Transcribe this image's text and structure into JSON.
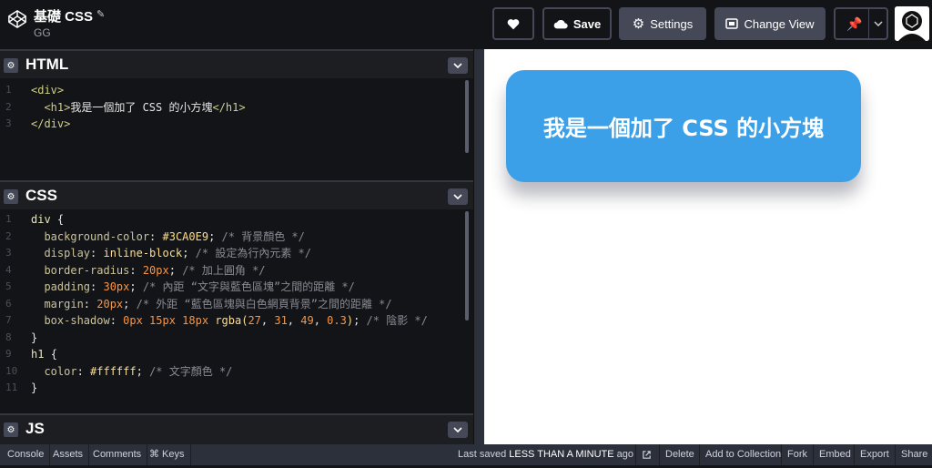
{
  "app": {
    "title": "基礎 CSS",
    "author": "GG"
  },
  "toolbar": {
    "save_label": "Save",
    "settings_label": "Settings",
    "change_view_label": "Change View"
  },
  "panels": {
    "html": {
      "label": "HTML",
      "lines": [
        {
          "n": "1",
          "parts": [
            {
              "c": "tag",
              "t": "<div>"
            }
          ]
        },
        {
          "n": "2",
          "parts": [
            {
              "c": "",
              "t": "  "
            },
            {
              "c": "tag",
              "t": "<h1>"
            },
            {
              "c": "",
              "t": "我是一個加了 CSS 的小方塊"
            },
            {
              "c": "tag",
              "t": "</h1>"
            }
          ]
        },
        {
          "n": "3",
          "parts": [
            {
              "c": "tag",
              "t": "</div>"
            }
          ]
        }
      ]
    },
    "css": {
      "label": "CSS",
      "lines": [
        {
          "n": "1",
          "parts": [
            {
              "c": "sel",
              "t": "div "
            },
            {
              "c": "",
              "t": "{"
            }
          ]
        },
        {
          "n": "2",
          "parts": [
            {
              "c": "prop",
              "t": "  background-color"
            },
            {
              "c": "",
              "t": ": "
            },
            {
              "c": "ident",
              "t": "#3CA0E9"
            },
            {
              "c": "",
              "t": "; "
            },
            {
              "c": "cmt",
              "t": "/* 背景顏色 */"
            }
          ]
        },
        {
          "n": "3",
          "parts": [
            {
              "c": "prop",
              "t": "  display"
            },
            {
              "c": "",
              "t": ": "
            },
            {
              "c": "ident",
              "t": "inline-block"
            },
            {
              "c": "",
              "t": "; "
            },
            {
              "c": "cmt",
              "t": "/* 設定為行內元素 */"
            }
          ]
        },
        {
          "n": "4",
          "parts": [
            {
              "c": "prop",
              "t": "  border-radius"
            },
            {
              "c": "",
              "t": ": "
            },
            {
              "c": "num",
              "t": "20px"
            },
            {
              "c": "",
              "t": "; "
            },
            {
              "c": "cmt",
              "t": "/* 加上圓角 */"
            }
          ]
        },
        {
          "n": "5",
          "parts": [
            {
              "c": "prop",
              "t": "  padding"
            },
            {
              "c": "",
              "t": ": "
            },
            {
              "c": "num",
              "t": "30px"
            },
            {
              "c": "",
              "t": "; "
            },
            {
              "c": "cmt",
              "t": "/* 內距 “文字與藍色區塊”之間的距離 */"
            }
          ]
        },
        {
          "n": "6",
          "parts": [
            {
              "c": "prop",
              "t": "  margin"
            },
            {
              "c": "",
              "t": ": "
            },
            {
              "c": "num",
              "t": "20px"
            },
            {
              "c": "",
              "t": "; "
            },
            {
              "c": "cmt",
              "t": "/* 外距 “藍色區塊與白色網頁背景”之間的距離 */"
            }
          ]
        },
        {
          "n": "7",
          "parts": [
            {
              "c": "prop",
              "t": "  box-shadow"
            },
            {
              "c": "",
              "t": ": "
            },
            {
              "c": "num",
              "t": "0px 15px 18px "
            },
            {
              "c": "ident",
              "t": "rgba("
            },
            {
              "c": "num",
              "t": "27"
            },
            {
              "c": "",
              "t": ", "
            },
            {
              "c": "num",
              "t": "31"
            },
            {
              "c": "",
              "t": ", "
            },
            {
              "c": "num",
              "t": "49"
            },
            {
              "c": "",
              "t": ", "
            },
            {
              "c": "num",
              "t": "0.3"
            },
            {
              "c": "ident",
              "t": ")"
            },
            {
              "c": "",
              "t": "; "
            },
            {
              "c": "cmt",
              "t": "/* 陰影 */"
            }
          ]
        },
        {
          "n": "8",
          "parts": [
            {
              "c": "",
              "t": "}"
            }
          ]
        },
        {
          "n": "9",
          "parts": [
            {
              "c": "sel",
              "t": "h1 "
            },
            {
              "c": "",
              "t": "{"
            }
          ]
        },
        {
          "n": "10",
          "parts": [
            {
              "c": "prop",
              "t": "  color"
            },
            {
              "c": "",
              "t": ": "
            },
            {
              "c": "ident",
              "t": "#ffffff"
            },
            {
              "c": "",
              "t": "; "
            },
            {
              "c": "cmt",
              "t": "/* 文字顏色 */"
            }
          ]
        },
        {
          "n": "11",
          "parts": [
            {
              "c": "",
              "t": "}"
            }
          ]
        }
      ]
    },
    "js": {
      "label": "JS"
    }
  },
  "preview": {
    "heading": "我是一個加了 CSS 的小方塊",
    "box_color": "#3CA0E9"
  },
  "footer": {
    "left": [
      "Console",
      "Assets",
      "Comments",
      "⌘ Keys"
    ],
    "last_saved_prefix": "Last saved",
    "last_saved_value": "LESS THAN A MINUTE",
    "last_saved_suffix": "ago",
    "right": [
      "Delete",
      "Add to Collection",
      "Fork",
      "Embed",
      "Export",
      "Share"
    ]
  }
}
